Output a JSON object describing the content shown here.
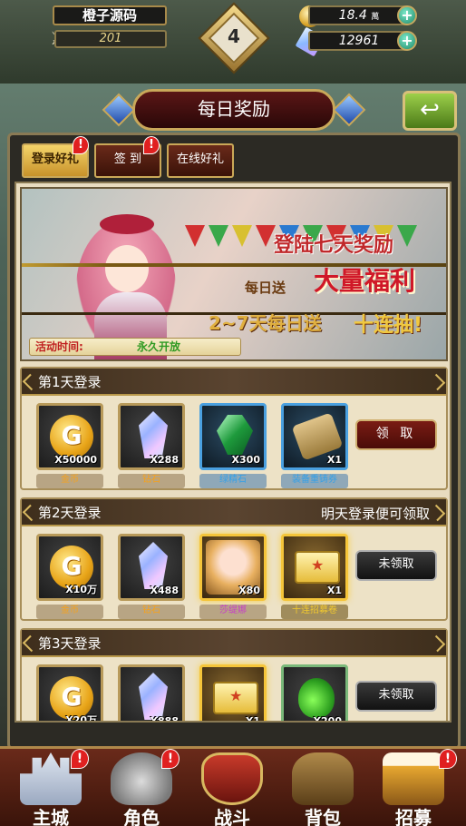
{
  "player": {
    "name": "橙子源码",
    "power": "201",
    "level": "4"
  },
  "currency": {
    "gold": {
      "value": "18.4",
      "unit": "萬"
    },
    "diamond": {
      "value": "12961"
    }
  },
  "header": {
    "title": "每日奖励"
  },
  "tabs": [
    {
      "label": "登录好礼",
      "active": true,
      "badge": "!"
    },
    {
      "label": "签 到",
      "active": false,
      "badge": "!"
    },
    {
      "label": "在线好礼",
      "active": false,
      "badge": ""
    }
  ],
  "banner": {
    "title": "登陆七天奖励",
    "highlight": "大量福利",
    "line1": "每日送",
    "line2": "2~7天每日送",
    "line3": "十连抽!",
    "event_time_label": "活动时间:",
    "event_time_value": "永久开放"
  },
  "days": [
    {
      "title": "第1天登录",
      "note": "",
      "button": "领 取",
      "button_state": "claim",
      "items": [
        {
          "icon": "gold-coin-icon",
          "qty": "X50000",
          "name": "金币",
          "color": "orange"
        },
        {
          "icon": "diamond-crystal-icon",
          "qty": "X288",
          "name": "钻石",
          "color": "orange"
        },
        {
          "icon": "emerald-icon",
          "qty": "X300",
          "name": "绿精石",
          "color": "blue"
        },
        {
          "icon": "scroll-icon",
          "qty": "X1",
          "name": "装备重铸券",
          "color": "blue"
        }
      ]
    },
    {
      "title": "第2天登录",
      "note": "明天登录便可领取",
      "button": "未领取",
      "button_state": "locked",
      "items": [
        {
          "icon": "gold-coin-icon",
          "qty": "X10万",
          "name": "金币",
          "color": "orange"
        },
        {
          "icon": "diamond-crystal-icon",
          "qty": "X488",
          "name": "钻石",
          "color": "orange"
        },
        {
          "icon": "hero-portrait-icon",
          "qty": "X80",
          "name": "莎缇娜",
          "color": "purple"
        },
        {
          "icon": "summon-book-icon",
          "qty": "X1",
          "name": "十连招募卷",
          "color": "gold"
        }
      ]
    },
    {
      "title": "第3天登录",
      "note": "",
      "button": "未领取",
      "button_state": "locked",
      "items": [
        {
          "icon": "gold-coin-icon",
          "qty": "X20万",
          "name": "",
          "color": "orange"
        },
        {
          "icon": "diamond-crystal-icon",
          "qty": "X888",
          "name": "",
          "color": "orange"
        },
        {
          "icon": "summon-book-icon",
          "qty": "X1",
          "name": "",
          "color": "gold"
        },
        {
          "icon": "green-potion-icon",
          "qty": "X200",
          "name": "",
          "color": "gold"
        }
      ]
    }
  ],
  "nav": [
    {
      "label": "主城",
      "badge": "!"
    },
    {
      "label": "角色",
      "badge": "!"
    },
    {
      "label": "战斗",
      "badge": ""
    },
    {
      "label": "背包",
      "badge": ""
    },
    {
      "label": "招募",
      "badge": "!"
    }
  ]
}
